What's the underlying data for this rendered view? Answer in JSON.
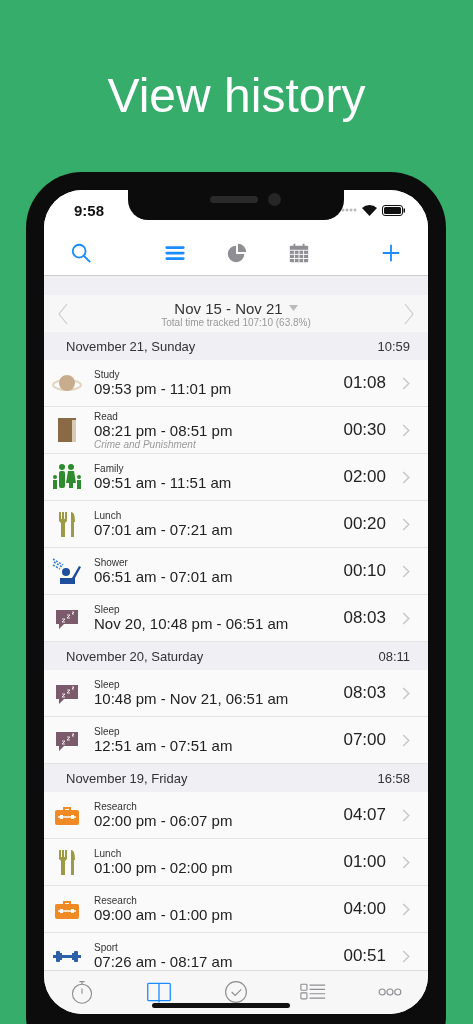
{
  "headline": "View history",
  "status_bar": {
    "time": "9:58"
  },
  "toolbar": {
    "views": [
      {
        "kind": "list",
        "selected": true
      },
      {
        "kind": "pie",
        "selected": false
      },
      {
        "kind": "calendar",
        "selected": false
      }
    ]
  },
  "week": {
    "range": "Nov 15 - Nov 21",
    "summary": "Total time tracked 107:10 (63.8%)"
  },
  "sections": [
    {
      "date": "November 21, Sunday",
      "total": "10:59",
      "entries": [
        {
          "kind": "planet",
          "category": "Study",
          "range": "09:53 pm - 11:01 pm",
          "duration": "01:08"
        },
        {
          "kind": "book",
          "category": "Read",
          "range": "08:21 pm - 08:51 pm",
          "note": "Crime and Punishment",
          "duration": "00:30"
        },
        {
          "kind": "family",
          "category": "Family",
          "range": "09:51 am - 11:51 am",
          "duration": "02:00"
        },
        {
          "kind": "cutlery",
          "category": "Lunch",
          "range": "07:01 am - 07:21 am",
          "duration": "00:20"
        },
        {
          "kind": "shower",
          "category": "Shower",
          "range": "06:51 am - 07:01 am",
          "duration": "00:10"
        },
        {
          "kind": "sleep",
          "category": "Sleep",
          "range": "Nov 20, 10:48 pm - 06:51 am",
          "duration": "08:03"
        }
      ]
    },
    {
      "date": "November 20, Saturday",
      "total": "08:11",
      "entries": [
        {
          "kind": "sleep",
          "category": "Sleep",
          "range": "10:48 pm - Nov 21, 06:51 am",
          "duration": "08:03"
        },
        {
          "kind": "sleep",
          "category": "Sleep",
          "range": "12:51 am - 07:51 am",
          "duration": "07:00"
        }
      ]
    },
    {
      "date": "November 19, Friday",
      "total": "16:58",
      "entries": [
        {
          "kind": "toolbox",
          "category": "Research",
          "range": "02:00 pm - 06:07 pm",
          "duration": "04:07"
        },
        {
          "kind": "cutlery",
          "category": "Lunch",
          "range": "01:00 pm - 02:00 pm",
          "duration": "01:00"
        },
        {
          "kind": "toolbox",
          "category": "Research",
          "range": "09:00 am - 01:00 pm",
          "duration": "04:00"
        },
        {
          "kind": "dumbbell",
          "category": "Sport",
          "range": "07:26 am - 08:17 am",
          "duration": "00:51"
        }
      ]
    }
  ],
  "tab_bar": [
    {
      "kind": "stopwatch",
      "selected": false
    },
    {
      "kind": "book",
      "selected": true
    },
    {
      "kind": "check",
      "selected": false
    },
    {
      "kind": "checklist",
      "selected": false
    },
    {
      "kind": "more",
      "selected": false
    }
  ]
}
